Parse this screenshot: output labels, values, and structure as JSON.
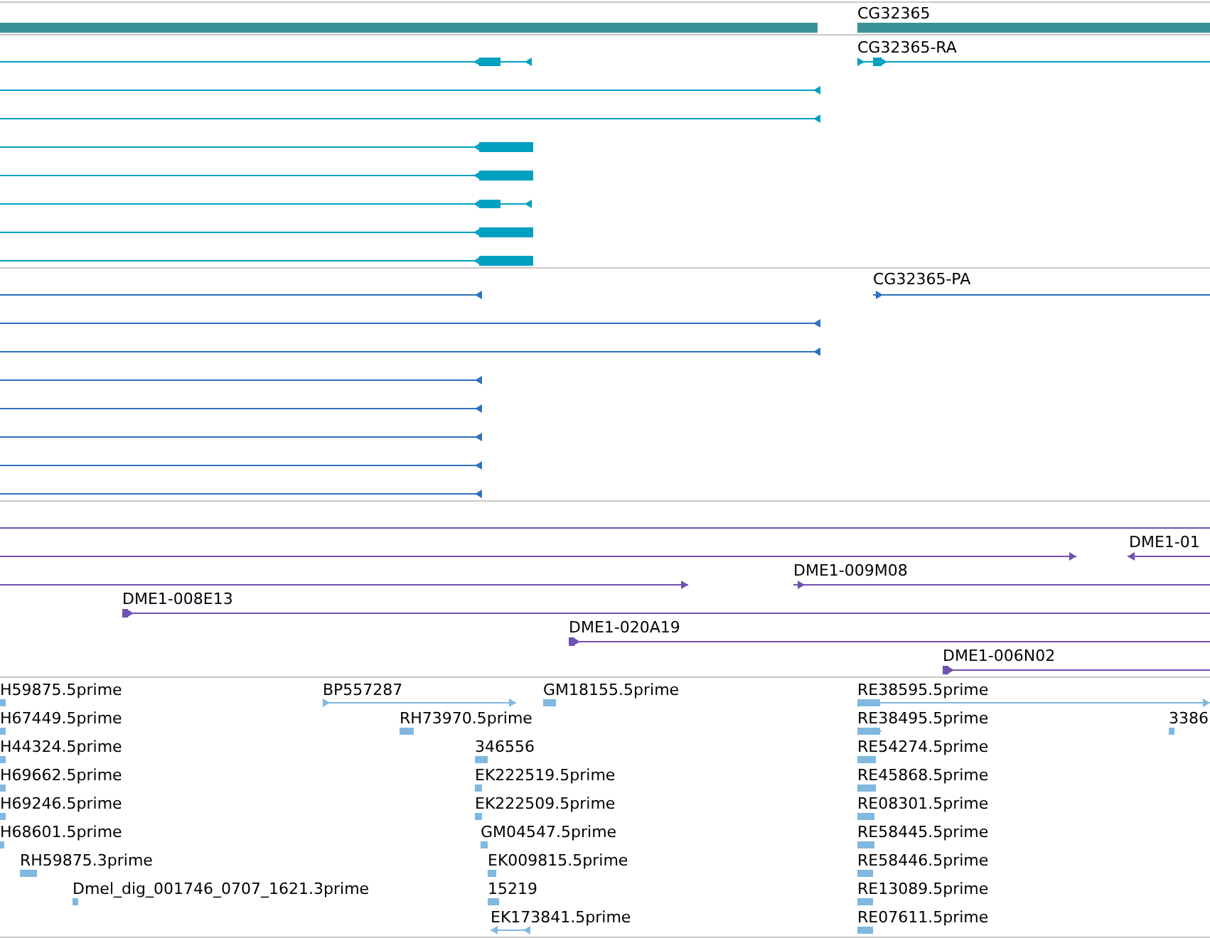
{
  "tracks": [
    {
      "kind": "gene",
      "features": [
        {
          "label": "CG32365"
        }
      ]
    },
    {
      "kind": "mrna",
      "features": [
        {
          "label": "CG32365-RA"
        }
      ]
    },
    {
      "kind": "protein",
      "features": [
        {
          "label": "CG32365-PA"
        }
      ]
    },
    {
      "kind": "clone",
      "features": [
        {
          "label": "DME1-01"
        },
        {
          "label": "DME1-009M08"
        },
        {
          "label": "DME1-008E13"
        },
        {
          "label": "DME1-020A19"
        },
        {
          "label": "DME1-006N02"
        }
      ]
    },
    {
      "kind": "est",
      "features": [
        {
          "label": "H59875.5prime"
        },
        {
          "label": "BP557287"
        },
        {
          "label": "GM18155.5prime"
        },
        {
          "label": "RE38595.5prime"
        },
        {
          "label": "H67449.5prime"
        },
        {
          "label": "RH73970.5prime"
        },
        {
          "label": "RE38495.5prime"
        },
        {
          "label": "3386"
        },
        {
          "label": "H44324.5prime"
        },
        {
          "label": "346556"
        },
        {
          "label": "RE54274.5prime"
        },
        {
          "label": "H69662.5prime"
        },
        {
          "label": "EK222519.5prime"
        },
        {
          "label": "RE45868.5prime"
        },
        {
          "label": "H69246.5prime"
        },
        {
          "label": "EK222509.5prime"
        },
        {
          "label": "RE08301.5prime"
        },
        {
          "label": "H68601.5prime"
        },
        {
          "label": "GM04547.5prime"
        },
        {
          "label": "RE58445.5prime"
        },
        {
          "label": "RH59875.3prime"
        },
        {
          "label": "EK009815.5prime"
        },
        {
          "label": "RE58446.5prime"
        },
        {
          "label": "Dmel_dig_001746_0707_1621.3prime"
        },
        {
          "label": "15219"
        },
        {
          "label": "RE13089.5prime"
        },
        {
          "label": "EK173841.5prime"
        },
        {
          "label": "RE07611.5prime"
        }
      ]
    }
  ]
}
